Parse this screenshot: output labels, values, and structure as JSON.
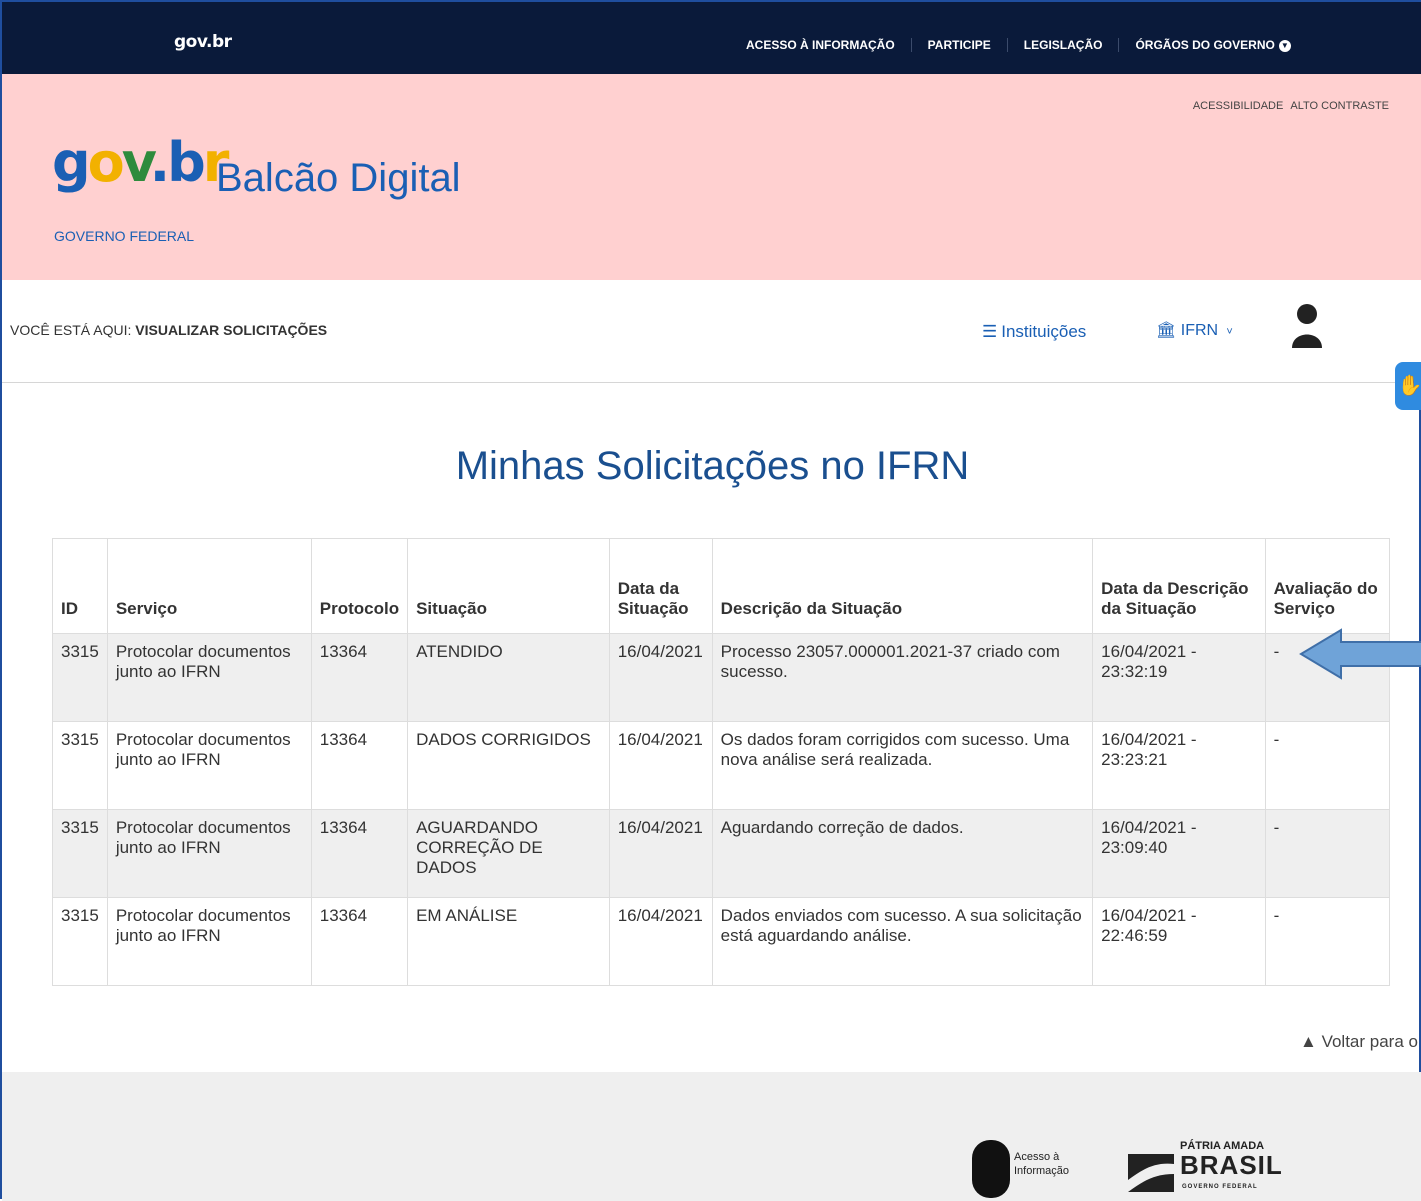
{
  "topbar": {
    "brand": "gov.br",
    "nav": [
      "ACESSO À INFORMAÇÃO",
      "PARTICIPE",
      "LEGISLAÇÃO",
      "ÓRGÃOS DO GOVERNO"
    ]
  },
  "header": {
    "accessibility": "ACESSIBILIDADE",
    "high_contrast": "ALTO CONTRASTE",
    "logo": {
      "g": "g",
      "o": "o",
      "v": "v",
      "dot": ".",
      "b": "b",
      "r": "r"
    },
    "app_name": "Balcão Digital",
    "subtitle": "GOVERNO FEDERAL"
  },
  "breadcrumb": {
    "prefix": "VOCÊ ESTÁ AQUI:",
    "current": "VISUALIZAR SOLICITAÇÕES"
  },
  "nav_right": {
    "institutions_label": "Instituições",
    "institution_selected": "IFRN"
  },
  "page": {
    "title": "Minhas Solicitações no IFRN"
  },
  "table": {
    "headers": [
      "ID",
      "Serviço",
      "Protocolo",
      "Situação",
      "Data da Situação",
      "Descrição da Situação",
      "Data da Descrição da Situação",
      "Avaliação do Serviço"
    ],
    "rows": [
      [
        "3315",
        "Protocolar documentos junto ao IFRN",
        "13364",
        "ATENDIDO",
        "16/04/2021",
        "Processo 23057.000001.2021-37 criado com sucesso.",
        "16/04/2021 - 23:32:19",
        "-"
      ],
      [
        "3315",
        "Protocolar documentos junto ao IFRN",
        "13364",
        "DADOS CORRIGIDOS",
        "16/04/2021",
        "Os dados foram corrigidos com sucesso. Uma nova análise será realizada.",
        "16/04/2021 - 23:23:21",
        "-"
      ],
      [
        "3315",
        "Protocolar documentos junto ao IFRN",
        "13364",
        "AGUARDANDO CORREÇÃO DE DADOS",
        "16/04/2021",
        "Aguardando correção de dados.",
        "16/04/2021 - 23:09:40",
        "-"
      ],
      [
        "3315",
        "Protocolar documentos junto ao IFRN",
        "13364",
        "EM ANÁLISE",
        "16/04/2021",
        "Dados enviados com sucesso. A sua solicitação está aguardando análise.",
        "16/04/2021 - 22:46:59",
        "-"
      ]
    ]
  },
  "back_to_top": "Voltar para o topo",
  "footer": {
    "acesso_line1": "Acesso à",
    "acesso_line2": "Informação",
    "patria_line1": "PÁTRIA AMADA",
    "patria_line2": "BRASIL",
    "patria_line3": "GOVERNO FEDERAL"
  },
  "colors": {
    "topbar": "#0a1a3a",
    "header_bg": "#ffd0d0",
    "primary_blue": "#1a5fb4",
    "title_blue": "#1a4f8f",
    "arrow_blue": "#6fa3d8"
  }
}
